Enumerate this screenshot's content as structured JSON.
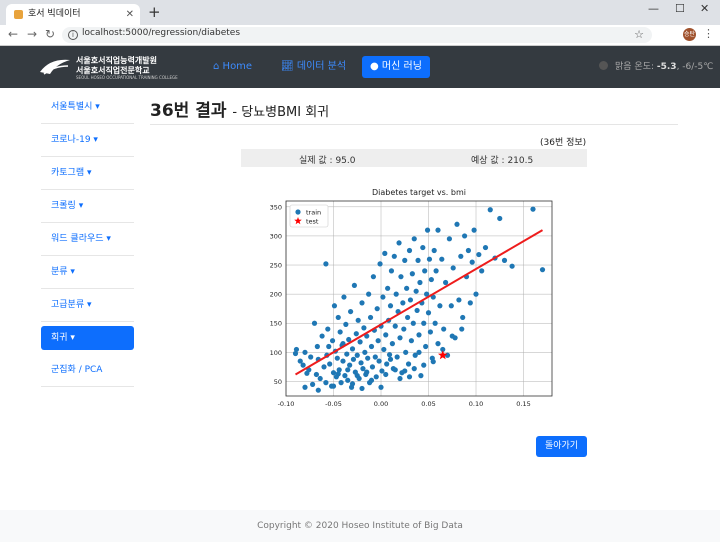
{
  "browser": {
    "tab_title": "호서 빅데이터",
    "url": "localhost:5000/regression/diabetes",
    "profile": "승탄"
  },
  "navbar": {
    "logo_line1": "서울호서직업능력개발원",
    "logo_line2": "서울호서직업전문학교",
    "logo_line3": "SEOUL HOSEO OCCUPATIONAL TRAINING COLLEGE",
    "links": [
      {
        "label": "Home",
        "icon": "home-icon"
      },
      {
        "label": "데이터 분석",
        "icon": "chart-icon"
      },
      {
        "label": "머신 러닝",
        "icon": "brain-icon",
        "active": true
      }
    ],
    "temperature_label": "맑음 온도:",
    "temperature_value": "-5.3",
    "temperature_range": ", -6/-5℃"
  },
  "sidebar": {
    "items": [
      {
        "label": "서울특별시 ▾"
      },
      {
        "label": "코로나-19 ▾"
      },
      {
        "label": "카토그램 ▾"
      },
      {
        "label": "크롤링 ▾"
      },
      {
        "label": "워드 클라우드 ▾"
      },
      {
        "label": "분류 ▾"
      },
      {
        "label": "고급분류 ▾"
      },
      {
        "label": "회귀 ▾",
        "active": true
      },
      {
        "label": "군집화 / PCA"
      }
    ]
  },
  "main": {
    "title": "36번 결과",
    "subtitle": "- 당뇨병BMI 회귀",
    "info_label": "(36번 정보)",
    "actual": "실제 값 : 95.0",
    "predicted": "예상 값 : 210.5",
    "back_button": "돌아가기"
  },
  "chart_data": {
    "type": "scatter",
    "title": "Diabetes target vs. bmi",
    "xlabel": "",
    "ylabel": "",
    "xlim": [
      -0.1,
      0.18
    ],
    "ylim": [
      25,
      360
    ],
    "xticks": [
      "-0.10",
      "-0.05",
      "0.00",
      "0.05",
      "0.10",
      "0.15"
    ],
    "yticks": [
      "50",
      "100",
      "150",
      "200",
      "250",
      "300",
      "350"
    ],
    "grid": true,
    "legend": "top-left",
    "legend_labels": [
      "train",
      "test"
    ],
    "colors": {
      "train": "#1f77b4",
      "test": "#ff0000",
      "line": "#ee1c1c"
    },
    "regression_line": {
      "x": [
        -0.09,
        0.17
      ],
      "y": [
        62,
        310
      ]
    },
    "test_point": {
      "x": 0.065,
      "y": 95
    },
    "train_points": [
      [
        -0.09,
        98
      ],
      [
        -0.089,
        105
      ],
      [
        -0.085,
        85
      ],
      [
        -0.082,
        78
      ],
      [
        -0.08,
        100
      ],
      [
        -0.078,
        64
      ],
      [
        -0.076,
        70
      ],
      [
        -0.074,
        92
      ],
      [
        -0.072,
        45
      ],
      [
        -0.07,
        150
      ],
      [
        -0.068,
        62
      ],
      [
        -0.067,
        110
      ],
      [
        -0.066,
        88
      ],
      [
        -0.064,
        55
      ],
      [
        -0.062,
        128
      ],
      [
        -0.06,
        75
      ],
      [
        -0.058,
        252
      ],
      [
        -0.057,
        95
      ],
      [
        -0.056,
        140
      ],
      [
        -0.054,
        80
      ],
      [
        -0.052,
        42
      ],
      [
        -0.051,
        120
      ],
      [
        -0.05,
        65
      ],
      [
        -0.049,
        180
      ],
      [
        -0.048,
        102
      ],
      [
        -0.047,
        58
      ],
      [
        -0.046,
        90
      ],
      [
        -0.045,
        160
      ],
      [
        -0.044,
        70
      ],
      [
        -0.043,
        135
      ],
      [
        -0.042,
        48
      ],
      [
        -0.041,
        112
      ],
      [
        -0.04,
        85
      ],
      [
        -0.039,
        195
      ],
      [
        -0.038,
        60
      ],
      [
        -0.037,
        148
      ],
      [
        -0.036,
        97
      ],
      [
        -0.035,
        52
      ],
      [
        -0.034,
        122
      ],
      [
        -0.033,
        78
      ],
      [
        -0.032,
        170
      ],
      [
        -0.031,
        40
      ],
      [
        -0.03,
        106
      ],
      [
        -0.029,
        88
      ],
      [
        -0.028,
        215
      ],
      [
        -0.027,
        66
      ],
      [
        -0.026,
        132
      ],
      [
        -0.025,
        95
      ],
      [
        -0.024,
        155
      ],
      [
        -0.023,
        55
      ],
      [
        -0.022,
        118
      ],
      [
        -0.021,
        82
      ],
      [
        -0.02,
        185
      ],
      [
        -0.019,
        72
      ],
      [
        -0.018,
        142
      ],
      [
        -0.017,
        100
      ],
      [
        -0.016,
        62
      ],
      [
        -0.015,
        128
      ],
      [
        -0.014,
        90
      ],
      [
        -0.013,
        200
      ],
      [
        -0.012,
        48
      ],
      [
        -0.011,
        160
      ],
      [
        -0.01,
        110
      ],
      [
        -0.009,
        75
      ],
      [
        -0.008,
        230
      ],
      [
        -0.007,
        138
      ],
      [
        -0.006,
        92
      ],
      [
        -0.005,
        58
      ],
      [
        -0.004,
        175
      ],
      [
        -0.003,
        120
      ],
      [
        -0.002,
        85
      ],
      [
        -0.001,
        252
      ],
      [
        0.0,
        145
      ],
      [
        0.001,
        68
      ],
      [
        0.002,
        195
      ],
      [
        0.003,
        105
      ],
      [
        0.004,
        270
      ],
      [
        0.005,
        130
      ],
      [
        0.006,
        80
      ],
      [
        0.007,
        210
      ],
      [
        0.008,
        155
      ],
      [
        0.009,
        96
      ],
      [
        0.01,
        180
      ],
      [
        0.011,
        240
      ],
      [
        0.012,
        115
      ],
      [
        0.013,
        72
      ],
      [
        0.014,
        265
      ],
      [
        0.015,
        145
      ],
      [
        0.016,
        200
      ],
      [
        0.017,
        92
      ],
      [
        0.018,
        170
      ],
      [
        0.019,
        288
      ],
      [
        0.02,
        125
      ],
      [
        0.021,
        230
      ],
      [
        0.022,
        65
      ],
      [
        0.023,
        185
      ],
      [
        0.024,
        140
      ],
      [
        0.025,
        258
      ],
      [
        0.026,
        100
      ],
      [
        0.027,
        210
      ],
      [
        0.028,
        160
      ],
      [
        0.029,
        80
      ],
      [
        0.03,
        275
      ],
      [
        0.031,
        190
      ],
      [
        0.032,
        120
      ],
      [
        0.033,
        235
      ],
      [
        0.034,
        150
      ],
      [
        0.035,
        295
      ],
      [
        0.036,
        95
      ],
      [
        0.037,
        205
      ],
      [
        0.038,
        172
      ],
      [
        0.039,
        258
      ],
      [
        0.04,
        130
      ],
      [
        0.041,
        220
      ],
      [
        0.042,
        60
      ],
      [
        0.043,
        185
      ],
      [
        0.044,
        280
      ],
      [
        0.045,
        150
      ],
      [
        0.046,
        240
      ],
      [
        0.047,
        110
      ],
      [
        0.048,
        200
      ],
      [
        0.049,
        310
      ],
      [
        0.05,
        168
      ],
      [
        0.051,
        260
      ],
      [
        0.052,
        135
      ],
      [
        0.053,
        225
      ],
      [
        0.054,
        90
      ],
      [
        0.055,
        195
      ],
      [
        0.056,
        275
      ],
      [
        0.057,
        150
      ],
      [
        0.058,
        240
      ],
      [
        0.06,
        310
      ],
      [
        0.062,
        180
      ],
      [
        0.064,
        260
      ],
      [
        0.066,
        140
      ],
      [
        0.068,
        220
      ],
      [
        0.07,
        95
      ],
      [
        0.072,
        295
      ],
      [
        0.074,
        180
      ],
      [
        0.076,
        245
      ],
      [
        0.078,
        125
      ],
      [
        0.08,
        320
      ],
      [
        0.082,
        190
      ],
      [
        0.084,
        265
      ],
      [
        0.086,
        160
      ],
      [
        0.088,
        300
      ],
      [
        0.09,
        230
      ],
      [
        0.092,
        275
      ],
      [
        0.094,
        185
      ],
      [
        0.096,
        255
      ],
      [
        0.098,
        310
      ],
      [
        0.1,
        200
      ],
      [
        0.103,
        268
      ],
      [
        0.106,
        240
      ],
      [
        0.11,
        280
      ],
      [
        0.115,
        345
      ],
      [
        0.12,
        262
      ],
      [
        0.125,
        330
      ],
      [
        0.13,
        258
      ],
      [
        0.138,
        248
      ],
      [
        0.16,
        346
      ],
      [
        0.17,
        242
      ],
      [
        -0.08,
        40
      ],
      [
        -0.066,
        35
      ],
      [
        -0.058,
        48
      ],
      [
        -0.05,
        42
      ],
      [
        -0.03,
        46
      ],
      [
        -0.02,
        38
      ],
      [
        -0.01,
        52
      ],
      [
        0.0,
        40
      ],
      [
        0.02,
        55
      ],
      [
        0.03,
        58
      ],
      [
        -0.045,
        63
      ],
      [
        -0.035,
        70
      ],
      [
        -0.025,
        60
      ],
      [
        -0.015,
        66
      ],
      [
        0.005,
        62
      ],
      [
        0.015,
        70
      ],
      [
        0.025,
        68
      ],
      [
        0.035,
        72
      ],
      [
        0.045,
        78
      ],
      [
        0.055,
        84
      ],
      [
        0.065,
        105
      ],
      [
        -0.055,
        110
      ],
      [
        -0.04,
        115
      ],
      [
        0.01,
        88
      ],
      [
        0.04,
        100
      ],
      [
        0.06,
        115
      ],
      [
        0.075,
        128
      ],
      [
        0.085,
        140
      ]
    ]
  }
}
